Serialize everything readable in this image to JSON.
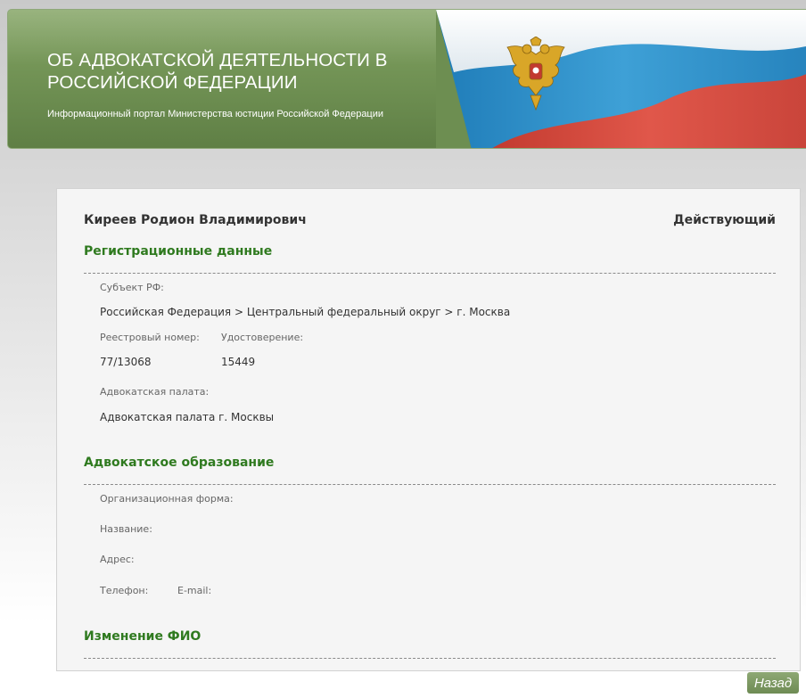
{
  "banner": {
    "title": "ОБ АДВОКАТСКОЙ ДЕЯТЕЛЬНОСТИ В РОССИЙСКОЙ ФЕДЕРАЦИИ",
    "subtitle": "Информационный портал Министерства юстиции Российской Федерации",
    "emblem_icon": "double-headed-eagle-emblem",
    "flag_colors": [
      "#ffffff",
      "#2b8fc6",
      "#d2443a"
    ]
  },
  "profile": {
    "name": "Киреев Родион Владимирович",
    "status": "Действующий"
  },
  "registration": {
    "title": "Регистрационные данные",
    "subject_label": "Субъект РФ:",
    "subject_value": "Российская Федерация > Центральный федеральный округ > г. Москва",
    "reg_number_label": "Реестровый номер:",
    "reg_number_value": "77/13068",
    "certificate_label": "Удостоверение:",
    "certificate_value": "15449",
    "chamber_label": "Адвокатская палата:",
    "chamber_value": "Адвокатская палата г. Москвы"
  },
  "education": {
    "title": "Адвокатское образование",
    "org_form_label": "Организационная форма:",
    "name_label": "Название:",
    "address_label": "Адрес:",
    "phone_label": "Телефон:",
    "email_label": "E-mail:"
  },
  "name_change": {
    "title": "Изменение ФИО"
  },
  "nav": {
    "back_label": "Назад"
  },
  "colors": {
    "accent_green": "#2f7a1f",
    "banner_green": "#6d8e51"
  }
}
